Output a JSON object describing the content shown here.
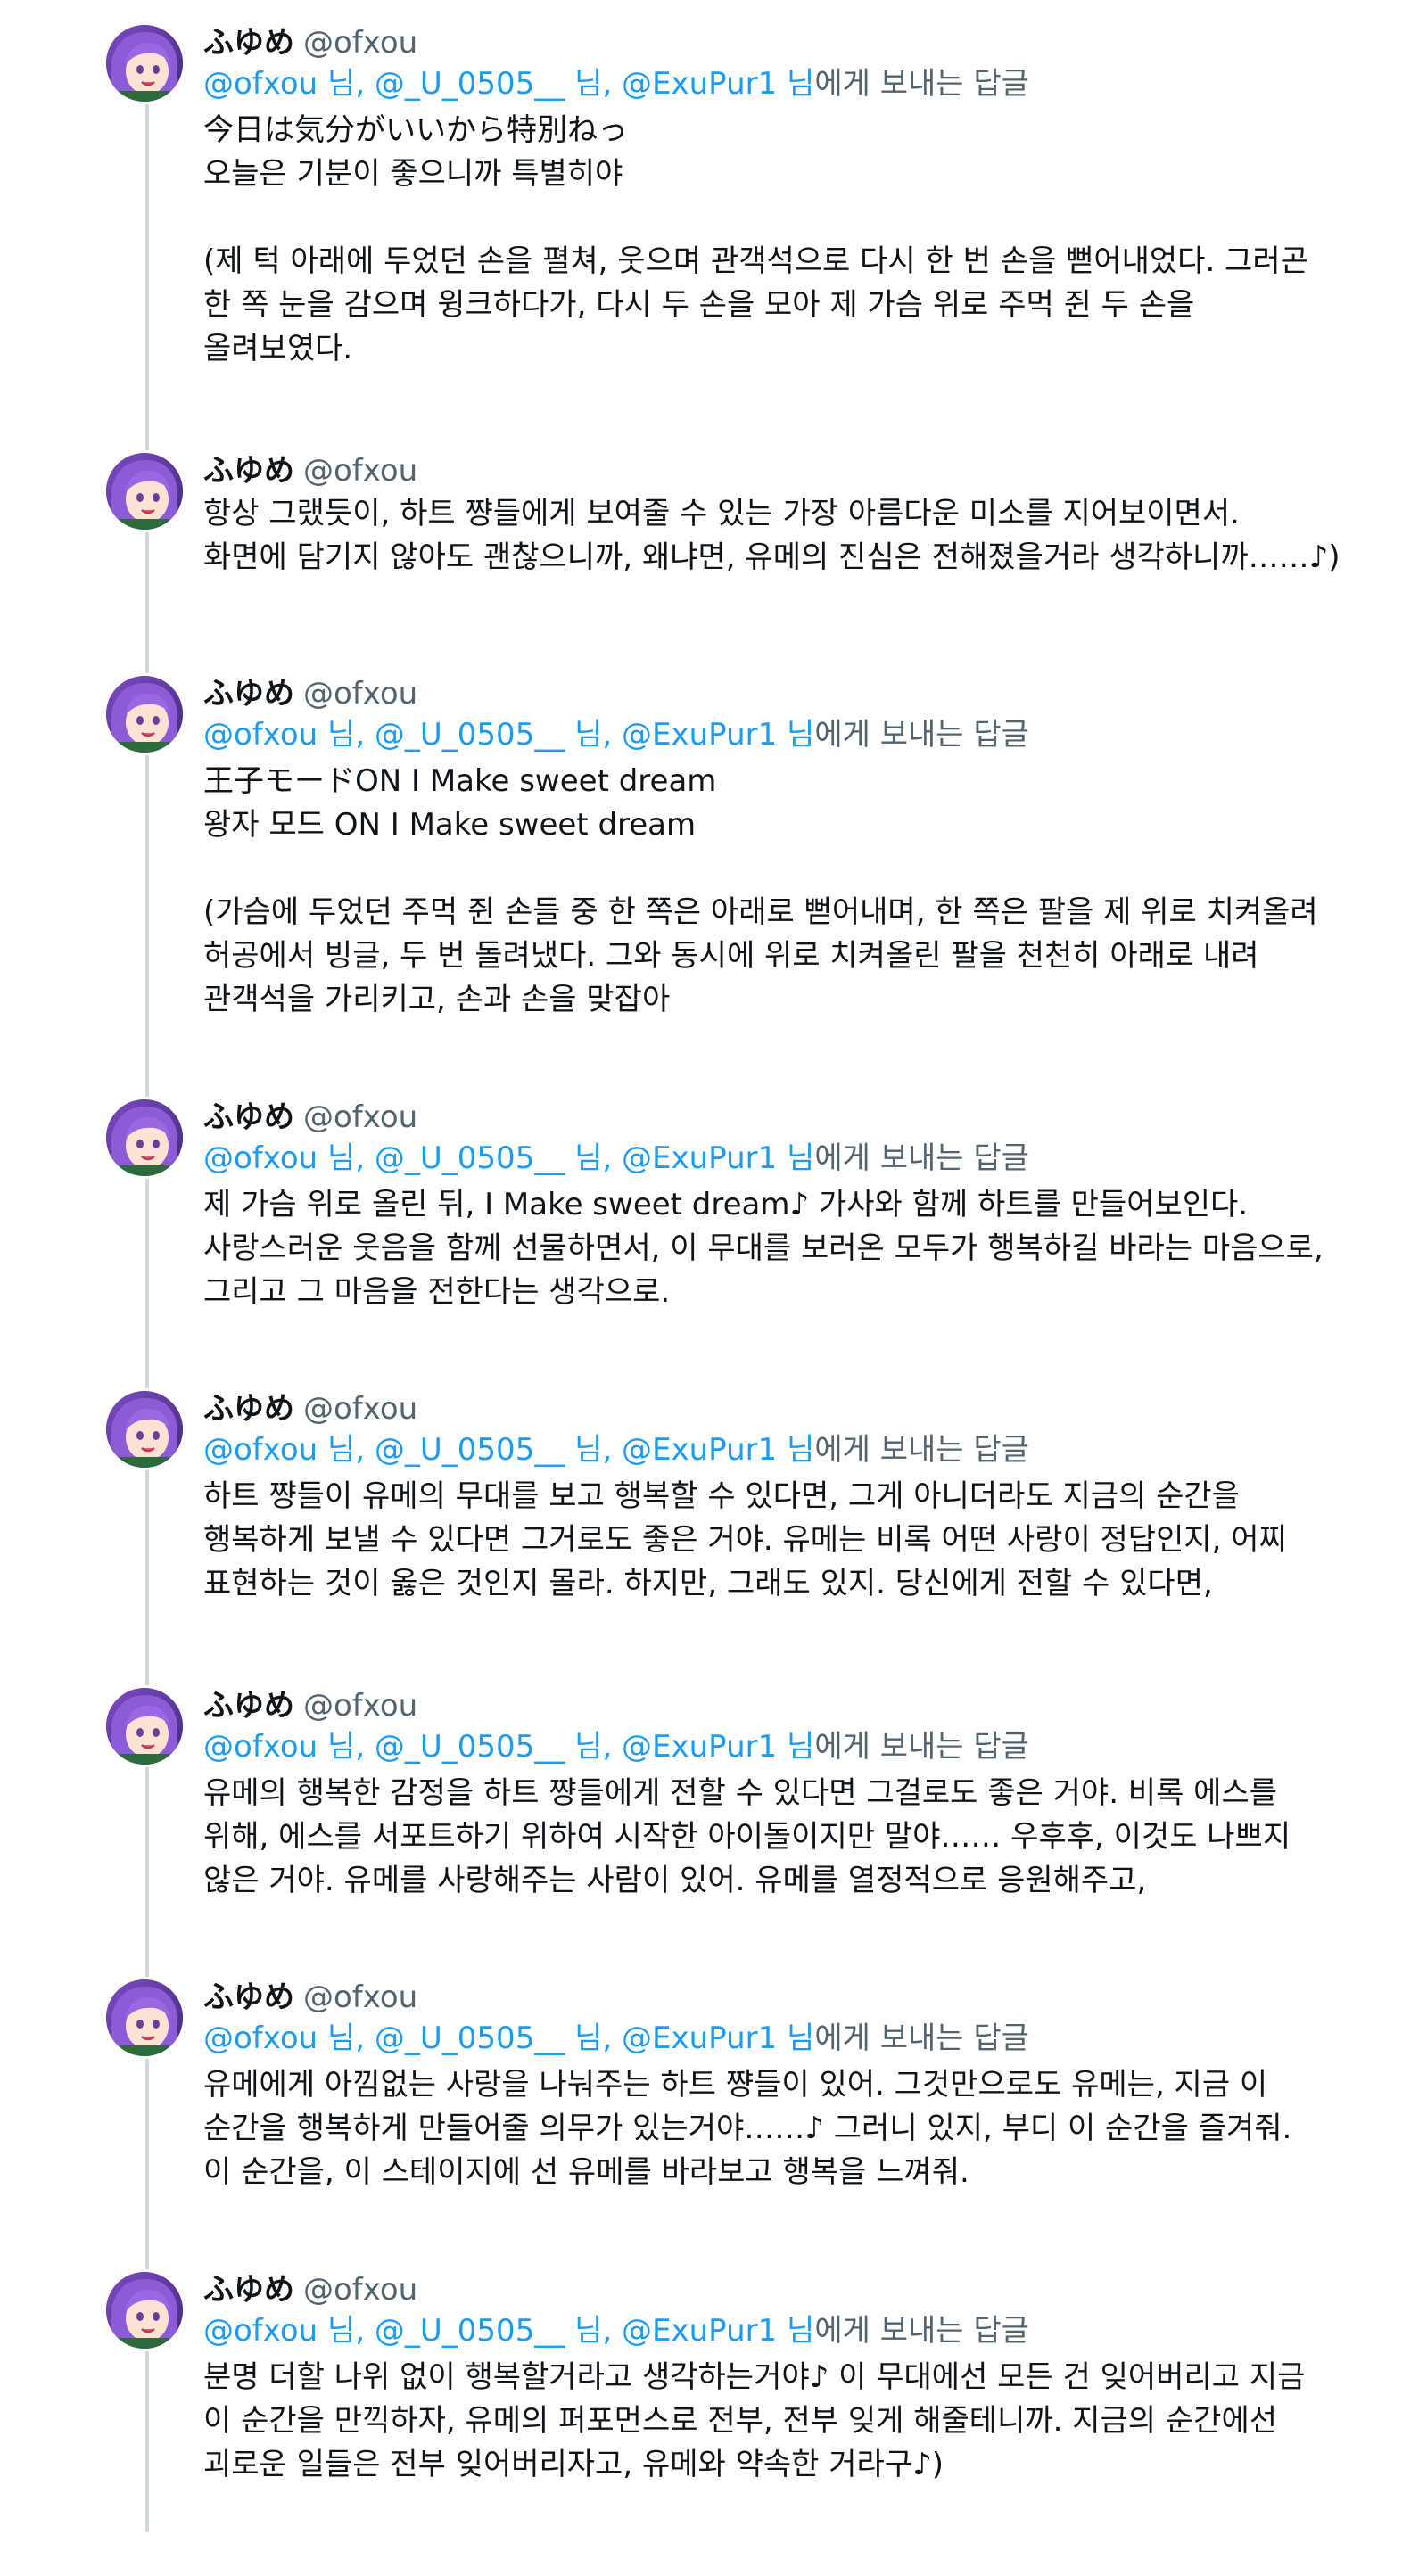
{
  "thread": {
    "tweets": [
      {
        "display_name": "ふゆめ",
        "handle": "@ofxou",
        "reply": {
          "mentions": [
            "@ofxou 님,",
            "@_U_0505__ 님,",
            "@ExuPur1 님"
          ],
          "suffix": "에게 보내는 답글"
        },
        "text": "今日は気分がいいから特別ねっ\n오늘은 기분이 좋으니까 특별히야\n\n(제 턱 아래에 두었던 손을 펼쳐, 웃으며 관객석으로 다시 한 번 손을 뻗어내었다. 그러곤\n한 쪽 눈을 감으며 윙크하다가, 다시 두 손을 모아 제 가슴 위로 주먹 쥔 두 손을\n올려보였다."
      },
      {
        "display_name": "ふゆめ",
        "handle": "@ofxou",
        "text": "항상 그랬듯이, 하트 쨩들에게 보여줄 수 있는 가장 아름다운 미소를 지어보이면서.\n화면에 담기지 않아도 괜찮으니까, 왜냐면, 유메의 진심은 전해졌을거라 생각하니까……♪)"
      },
      {
        "display_name": "ふゆめ",
        "handle": "@ofxou",
        "reply": {
          "mentions": [
            "@ofxou 님,",
            "@_U_0505__ 님,",
            "@ExuPur1 님"
          ],
          "suffix": "에게 보내는 답글"
        },
        "text": "王子モードON I Make sweet dream\n왕자 모드 ON I Make sweet dream\n\n(가슴에 두었던 주먹 쥔 손들 중 한 쪽은 아래로 뻗어내며, 한 쪽은 팔을 제 위로 치켜올려\n허공에서 빙글, 두 번 돌려냈다. 그와 동시에 위로 치켜올린 팔을 천천히 아래로 내려\n관객석을 가리키고, 손과 손을 맞잡아"
      },
      {
        "display_name": "ふゆめ",
        "handle": "@ofxou",
        "reply": {
          "mentions": [
            "@ofxou 님,",
            "@_U_0505__ 님,",
            "@ExuPur1 님"
          ],
          "suffix": "에게 보내는 답글"
        },
        "text": "제 가슴 위로 올린 뒤, I Make sweet dream♪ 가사와 함께 하트를 만들어보인다.\n사랑스러운 웃음을 함께 선물하면서, 이 무대를 보러온 모두가 행복하길 바라는 마음으로,\n그리고 그 마음을 전한다는 생각으로."
      },
      {
        "display_name": "ふゆめ",
        "handle": "@ofxou",
        "reply": {
          "mentions": [
            "@ofxou 님,",
            "@_U_0505__ 님,",
            "@ExuPur1 님"
          ],
          "suffix": "에게 보내는 답글"
        },
        "text": "하트 쨩들이 유메의 무대를 보고 행복할 수 있다면, 그게 아니더라도 지금의 순간을\n행복하게 보낼 수 있다면 그거로도 좋은 거야. 유메는 비록 어떤 사랑이 정답인지, 어찌\n표현하는 것이 옳은 것인지 몰라. 하지만, 그래도 있지. 당신에게 전할 수 있다면,"
      },
      {
        "display_name": "ふゆめ",
        "handle": "@ofxou",
        "reply": {
          "mentions": [
            "@ofxou 님,",
            "@_U_0505__ 님,",
            "@ExuPur1 님"
          ],
          "suffix": "에게 보내는 답글"
        },
        "text": "유메의 행복한 감정을 하트 쨩들에게 전할 수 있다면 그걸로도 좋은 거야. 비록 에스를\n위해, 에스를 서포트하기 위하여 시작한 아이돌이지만 말야…… 우후후, 이것도 나쁘지\n않은 거야. 유메를 사랑해주는 사람이 있어. 유메를 열정적으로 응원해주고,"
      },
      {
        "display_name": "ふゆめ",
        "handle": "@ofxou",
        "reply": {
          "mentions": [
            "@ofxou 님,",
            "@_U_0505__ 님,",
            "@ExuPur1 님"
          ],
          "suffix": "에게 보내는 답글"
        },
        "text": "유메에게 아낌없는 사랑을 나눠주는 하트 쨩들이 있어. 그것만으로도 유메는, 지금 이\n순간을 행복하게 만들어줄 의무가 있는거야……♪ 그러니 있지, 부디 이 순간을 즐겨줘.\n이 순간을, 이 스테이지에 선 유메를 바라보고 행복을 느껴줘."
      },
      {
        "display_name": "ふゆめ",
        "handle": "@ofxou",
        "reply": {
          "mentions": [
            "@ofxou 님,",
            "@_U_0505__ 님,",
            "@ExuPur1 님"
          ],
          "suffix": "에게 보내는 답글"
        },
        "text": "분명 더할 나위 없이 행복할거라고 생각하는거야♪ 이 무대에선 모든 건 잊어버리고 지금\n이 순간을 만끽하자, 유메의 퍼포먼스로 전부, 전부 잊게 해줄테니까. 지금의 순간에선\n괴로운 일들은 전부 잊어버리자고, 유메와 약속한 거라구♪)"
      }
    ]
  }
}
